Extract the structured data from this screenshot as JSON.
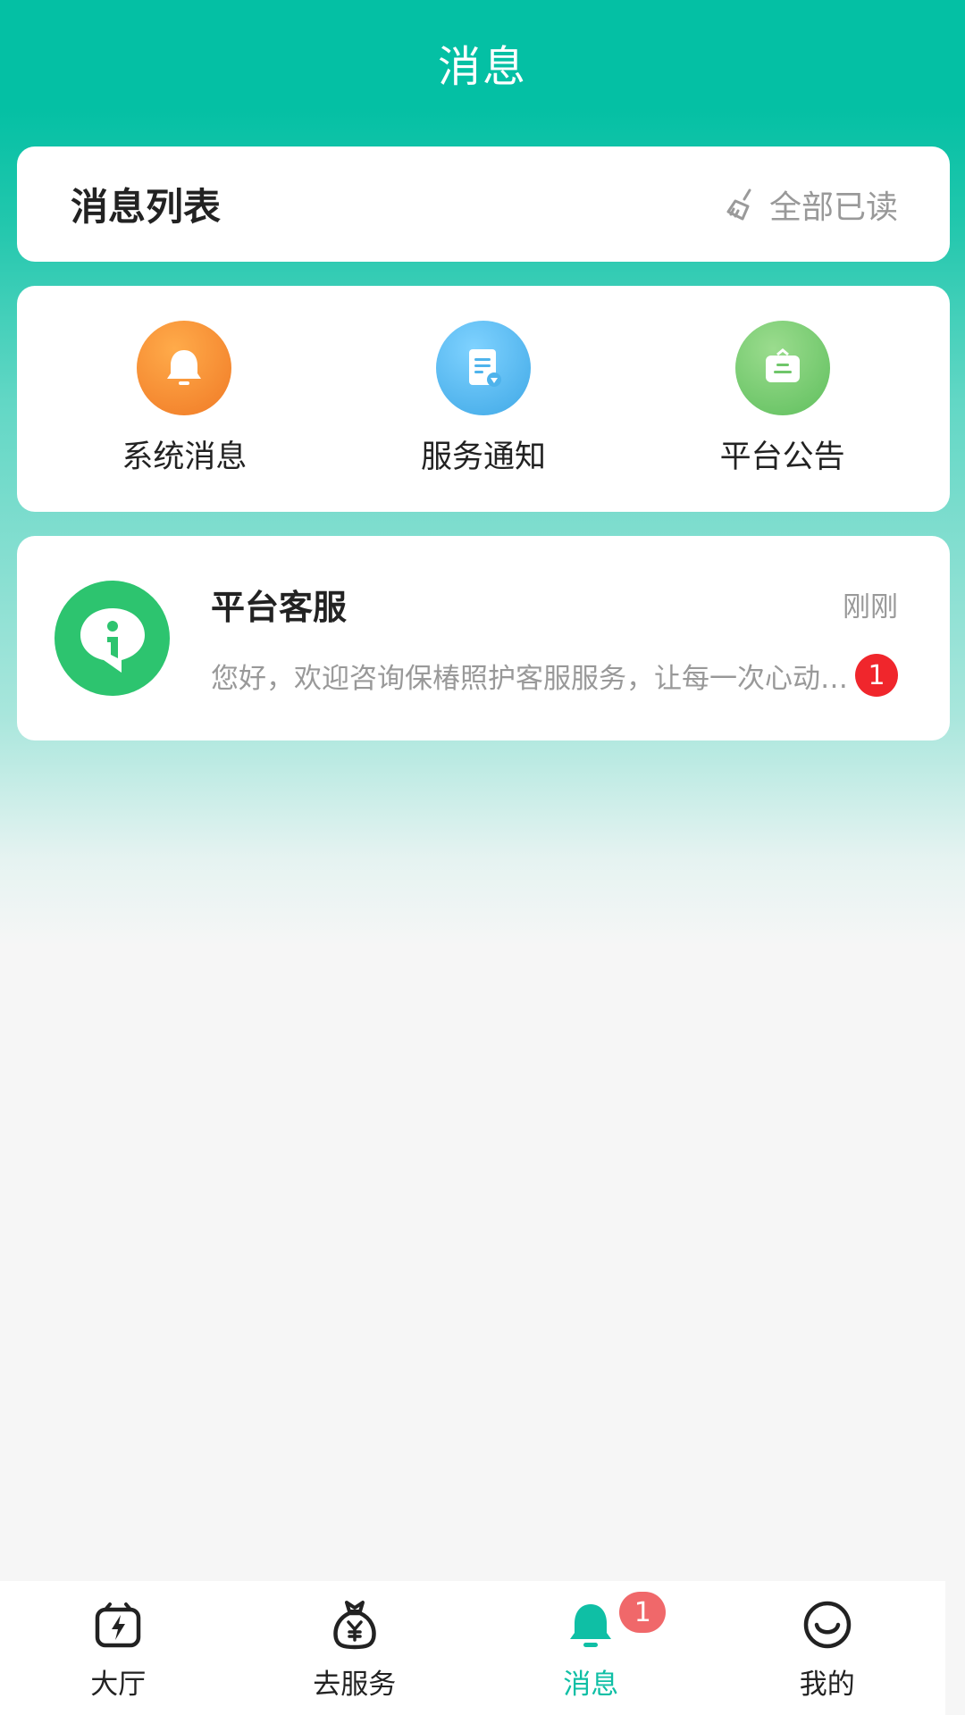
{
  "header": {
    "title": "消息"
  },
  "list": {
    "title": "消息列表",
    "mark_all_read": "全部已读",
    "mark_icon": "broom-icon"
  },
  "categories": [
    {
      "label": "系统消息",
      "icon": "bell-icon",
      "color": "#f38a31"
    },
    {
      "label": "服务通知",
      "icon": "document-icon",
      "color": "#4eb3ec"
    },
    {
      "label": "平台公告",
      "icon": "bag-icon",
      "color": "#6fc66a"
    }
  ],
  "chats": [
    {
      "name": "平台客服",
      "time": "刚刚",
      "preview": "您好，欢迎咨询保椿照护客服服务，让每一次心动都被温柔以待",
      "unread": "1",
      "avatar": "info-bubble-icon"
    }
  ],
  "tabs": [
    {
      "label": "大厅",
      "icon": "hall-icon"
    },
    {
      "label": "去服务",
      "icon": "money-bag-icon"
    },
    {
      "label": "消息",
      "icon": "bell-icon",
      "badge": "1",
      "active": true
    },
    {
      "label": "我的",
      "icon": "smile-icon"
    }
  ],
  "colors": {
    "brand": "#04c0a4",
    "active_tab": "#0fbfa5",
    "badge": "#f0262c"
  }
}
